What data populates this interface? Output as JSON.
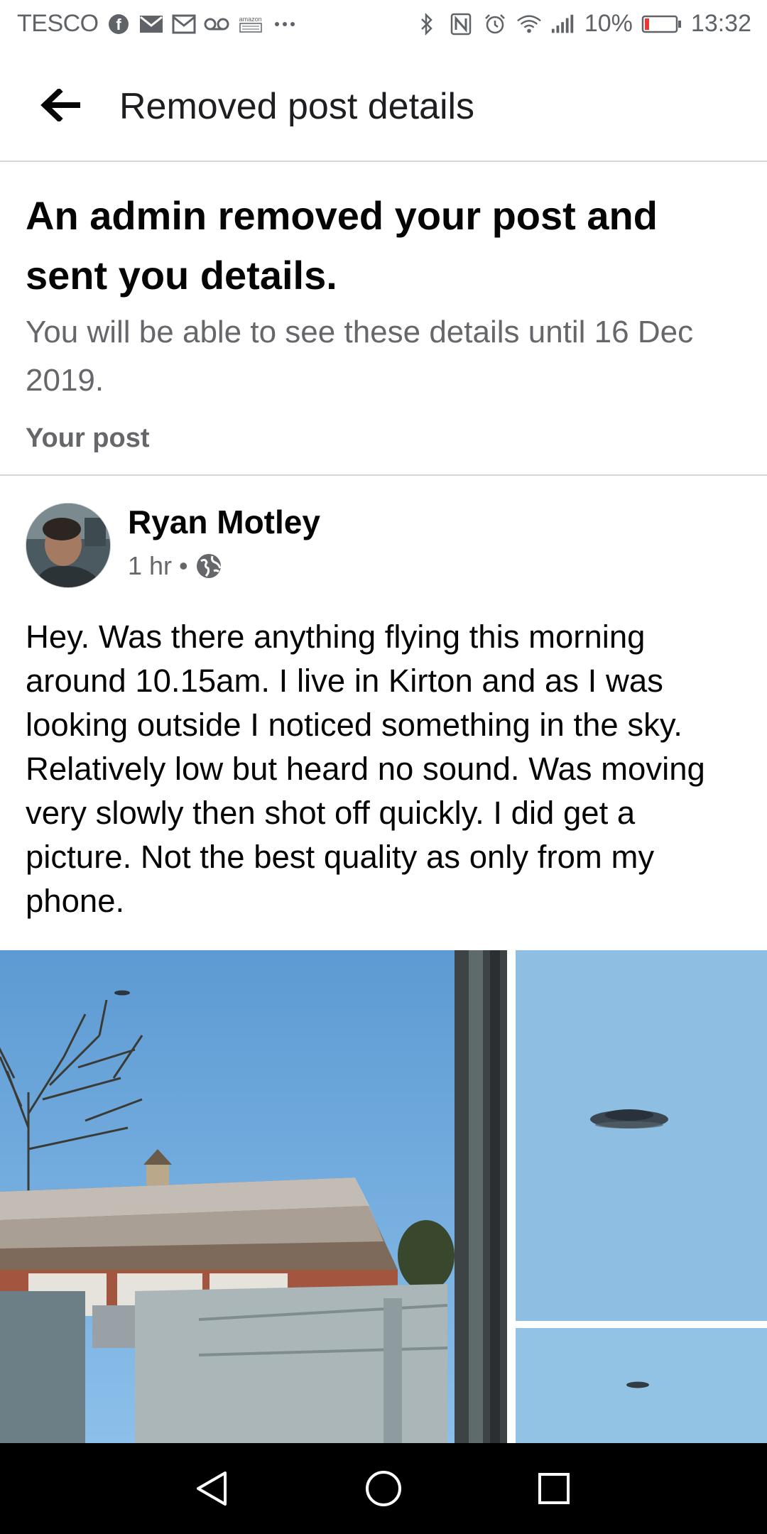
{
  "status_bar": {
    "carrier": "TESCO",
    "battery": "10%",
    "time": "13:32",
    "amazon_label": "amazon",
    "icons_left": [
      "facebook-icon",
      "gmail-icon",
      "mail-icon",
      "voicemail-icon",
      "amazon-icon",
      "more-icon"
    ],
    "icons_right": [
      "bluetooth-icon",
      "nfc-icon",
      "alarm-icon",
      "wifi-icon",
      "signal-icon",
      "battery-icon"
    ]
  },
  "header": {
    "title": "Removed post details",
    "back_icon": "arrow-left-icon"
  },
  "notice": {
    "heading": "An admin removed your post and sent you details.",
    "subtext": "You will be able to see these details until 16 Dec 2019.",
    "section_label": "Your post"
  },
  "post": {
    "author": "Ryan Motley",
    "time": "1 hr",
    "separator": "•",
    "privacy_icon": "globe-icon",
    "text": "Hey. Was there anything flying this morning around 10.15am. I live in Kirton and as I was looking outside I noticed something in the sky. Relatively low but heard no sound. Was moving very slowly then shot off quickly. I did get a picture. Not the best quality as only from my phone."
  },
  "colors": {
    "sky": "#6aa6d8",
    "battery_low": "#e53935",
    "secondary_text": "#65676b"
  },
  "nav_bar": {
    "icons": [
      "back-triangle-icon",
      "home-circle-icon",
      "recents-square-icon"
    ]
  }
}
